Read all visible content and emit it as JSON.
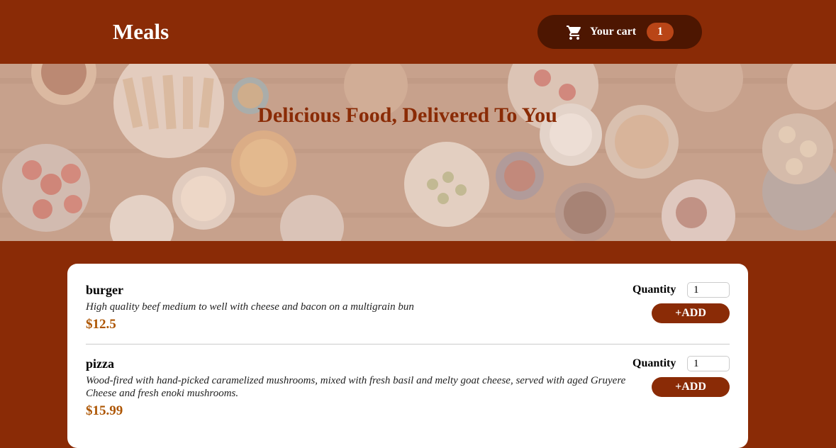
{
  "header": {
    "brand": "Meals",
    "cart": {
      "label": "Your cart",
      "count": "1",
      "icon": "shopping-cart-icon"
    }
  },
  "hero": {
    "title": "Delicious Food, Delivered To You"
  },
  "meals": [
    {
      "name": "burger",
      "description": "High quality beef medium to well with cheese and bacon on a multigrain bun",
      "price": "$12.5",
      "quantity_label": "Quantity",
      "quantity_value": "1",
      "add_label": "+ADD"
    },
    {
      "name": "pizza",
      "description": "Wood-fired with hand-picked caramelized mushrooms, mixed with fresh basil and melty goat cheese, served with aged Gruyere Cheese and fresh enoki mushrooms.",
      "price": "$15.99",
      "quantity_label": "Quantity",
      "quantity_value": "1",
      "add_label": "+ADD"
    }
  ],
  "colors": {
    "primary": "#8a2b06",
    "cart_bg": "#4d1601",
    "badge": "#b94517",
    "price": "#ad5502"
  }
}
